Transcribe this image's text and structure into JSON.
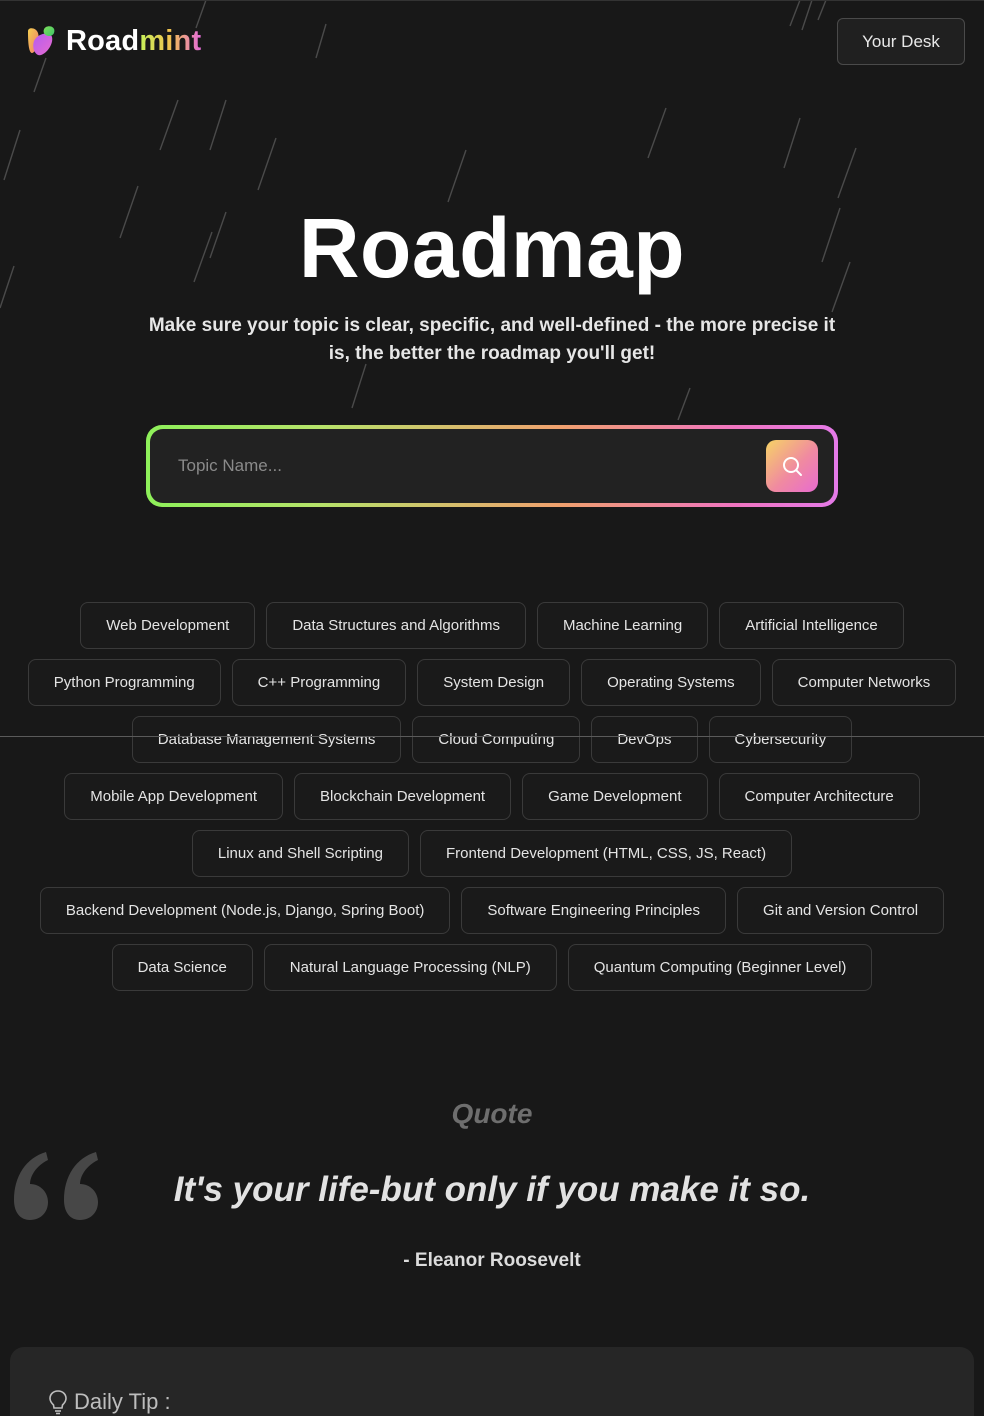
{
  "header": {
    "brand_part1": "Road",
    "brand_part2": "mint",
    "desk_button": "Your Desk"
  },
  "hero": {
    "title": "Roadmap",
    "subtitle": "Make sure your topic is clear, specific, and well-defined - the more precise it is, the better the roadmap you'll get!"
  },
  "search": {
    "placeholder": "Topic Name...",
    "icon": "search-icon"
  },
  "topics": [
    [
      "Web Development",
      "Data Structures and Algorithms",
      "Machine Learning",
      "Artificial Intelligence"
    ],
    [
      "Python Programming",
      "C++ Programming",
      "System Design",
      "Operating Systems",
      "Computer Networks"
    ],
    [
      "Database Management Systems",
      "Cloud Computing",
      "DevOps",
      "Cybersecurity"
    ],
    [
      "Mobile App Development",
      "Blockchain Development",
      "Game Development",
      "Computer Architecture"
    ],
    [
      "Linux and Shell Scripting",
      "Frontend Development (HTML, CSS, JS, React)"
    ],
    [
      "Backend Development (Node.js, Django, Spring Boot)",
      "Software Engineering Principles",
      "Git and Version Control"
    ],
    [
      "Data Science",
      "Natural Language Processing (NLP)",
      "Quantum Computing (Beginner Level)"
    ]
  ],
  "quote": {
    "heading": "Quote",
    "text": "It's your life-but only if you make it so.",
    "author": "- Eleanor Roosevelt",
    "icon": "quote-mark-icon"
  },
  "tip": {
    "title": "Daily Tip :",
    "icon": "lightbulb-icon"
  },
  "colors": {
    "background": "#181818",
    "accent_green": "#8ef05a",
    "accent_pink": "#e86bd0",
    "accent_yellow": "#f6d365"
  }
}
